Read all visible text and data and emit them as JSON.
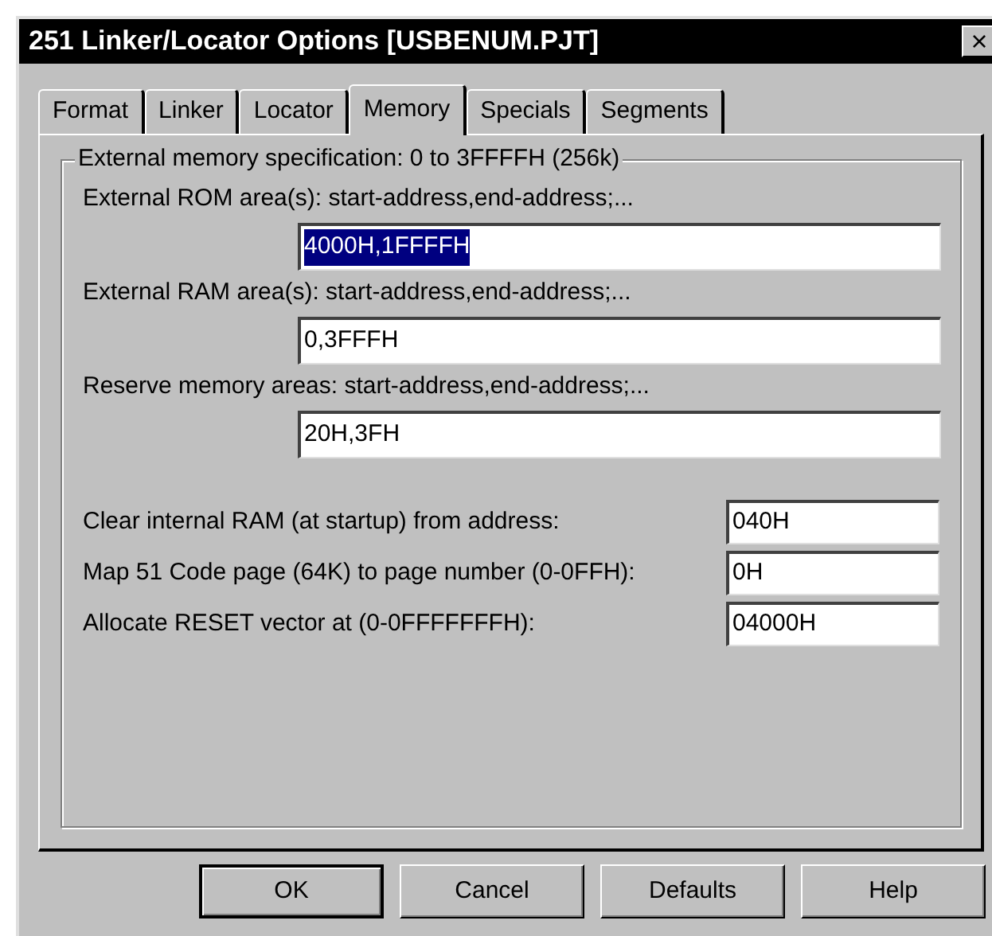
{
  "window": {
    "title": "251 Linker/Locator Options [USBENUM.PJT]",
    "close": "×"
  },
  "tabs": [
    {
      "label": "Format",
      "selected": false
    },
    {
      "label": "Linker",
      "selected": false
    },
    {
      "label": "Locator",
      "selected": false
    },
    {
      "label": "Memory",
      "selected": true
    },
    {
      "label": "Specials",
      "selected": false
    },
    {
      "label": "Segments",
      "selected": false
    }
  ],
  "group": {
    "title": "External memory specification: 0 to 3FFFFH (256k)",
    "wide_fields": [
      {
        "label": "External ROM area(s): start-address,end-address;...",
        "value": "4000H,1FFFFH",
        "text_selected": true
      },
      {
        "label": "External RAM area(s): start-address,end-address;...",
        "value": "0,3FFFH",
        "text_selected": false
      },
      {
        "label": "Reserve memory areas: start-address,end-address;...",
        "value": "20H,3FH",
        "text_selected": false
      }
    ],
    "short_fields": [
      {
        "label": "Clear internal RAM (at startup) from address:",
        "value": "040H"
      },
      {
        "label": "Map 51 Code page (64K) to page number (0-0FFH):",
        "value": "0H"
      },
      {
        "label": "Allocate RESET vector at (0-0FFFFFFFH):",
        "value": "04000H"
      }
    ]
  },
  "buttons": [
    {
      "label": "OK",
      "default": true
    },
    {
      "label": "Cancel",
      "default": false
    },
    {
      "label": "Defaults",
      "default": false
    },
    {
      "label": "Help",
      "default": false
    }
  ]
}
